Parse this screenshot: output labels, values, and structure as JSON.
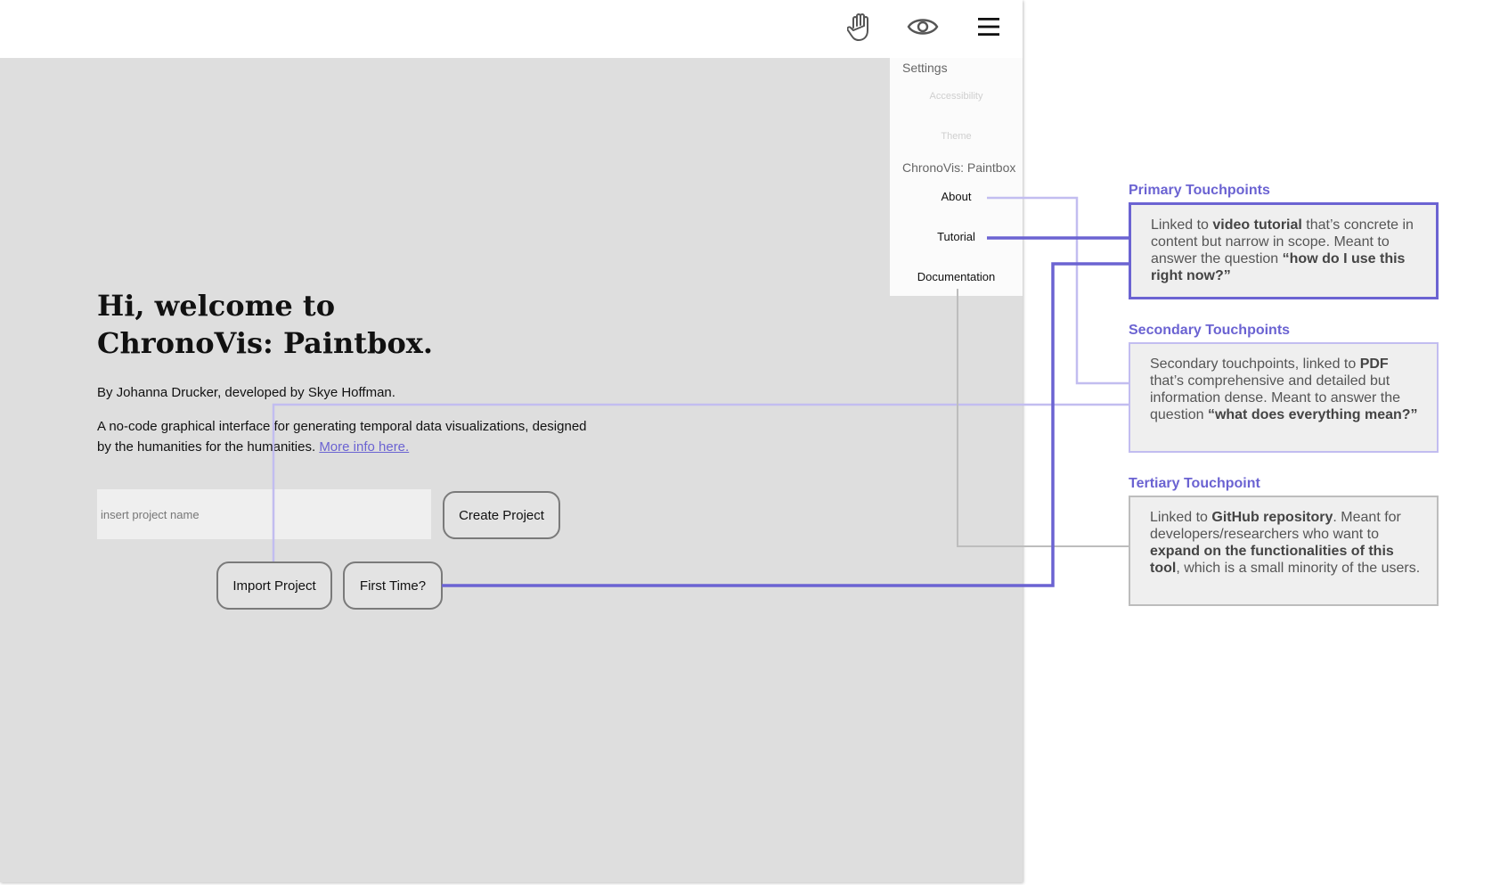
{
  "toolbar": {
    "icons": [
      "hand-icon",
      "eye-icon",
      "hamburger-menu-icon"
    ]
  },
  "menu": {
    "settings_label": "Settings",
    "accessibility_label": "Accessibility",
    "theme_label": "Theme",
    "app_heading": "ChronoVis: Paintbox",
    "about_label": "About",
    "tutorial_label": "Tutorial",
    "documentation_label": "Documentation"
  },
  "hero": {
    "title_line1": "Hi, welcome to",
    "title_line2": "ChronoVis: Paintbox.",
    "byline": "By Johanna Drucker, developed by Skye Hoffman.",
    "description": "A no-code graphical interface for generating temporal data visualizations, designed by the humanities for the humanities.",
    "more_info_link": "More info here."
  },
  "project": {
    "name_placeholder": "insert project name",
    "create_label": "Create Project",
    "import_label": "Import Project",
    "first_time_label": "First Time?"
  },
  "annotations": {
    "primary": {
      "title": "Primary Touchpoints",
      "t1": "Linked to ",
      "b1": "video tutorial",
      "t2": " that’s concrete in content but narrow in scope. Meant to answer the question ",
      "b2": "“how do I use this right now?”"
    },
    "secondary": {
      "title": "Secondary Touchpoints",
      "t1": "Secondary touchpoints, linked to ",
      "b1": "PDF",
      "t2": " that’s comprehensive and detailed but information dense. Meant to answer the question ",
      "b2": "“what does everything mean?”"
    },
    "tertiary": {
      "title": "Tertiary Touchpoint",
      "t1": "Linked to ",
      "b1": "GitHub repository",
      "t2": ". Meant for developers/researchers who want to ",
      "b2": "expand on the functionalities of this tool",
      "t3": ", which is a small minority of the users."
    }
  },
  "colors": {
    "accent": "#6b63d2",
    "accent_light": "#c2bdf0",
    "neutral_line": "#bdbdbd",
    "canvas": "#dedede"
  }
}
